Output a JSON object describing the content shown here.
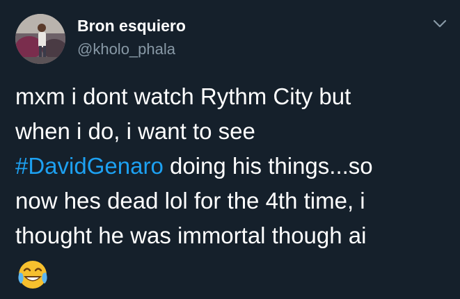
{
  "user": {
    "display_name": "Bron esquiero",
    "handle": "@kholo_phala"
  },
  "tweet": {
    "line1": "mxm i dont watch Rythm City but",
    "line2": "when i do, i want to see",
    "hashtag": "#DavidGenaro",
    "line3_rest": " doing his things...so",
    "line4": "now  hes dead lol for the 4th time, i",
    "line5": "thought he was immortal though ai"
  },
  "icons": {
    "menu": "chevron-down-icon",
    "emoji": "face-with-tears-of-joy-icon"
  },
  "colors": {
    "background": "#15202b",
    "text": "#ffffff",
    "secondary_text": "#8899a6",
    "link": "#1da1f2"
  }
}
